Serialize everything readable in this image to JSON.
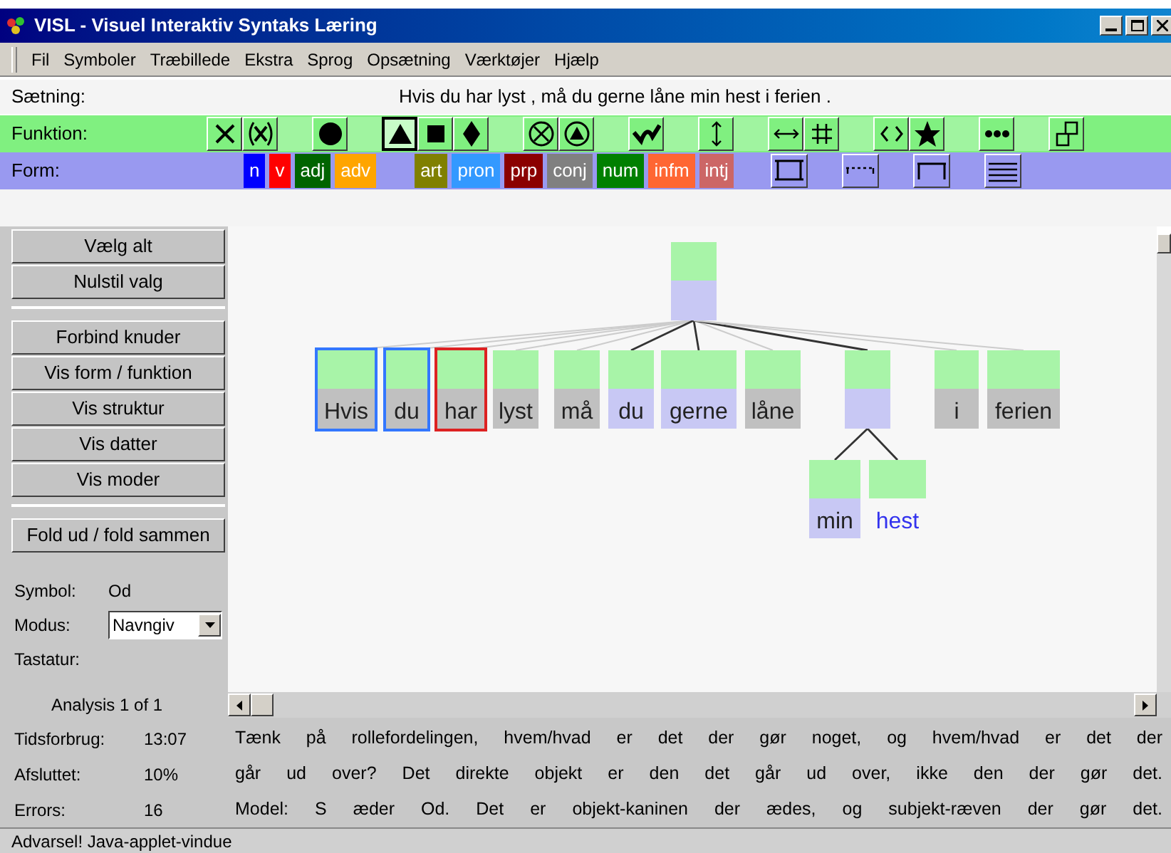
{
  "window": {
    "title": "VISL - Visuel Interaktiv Syntaks Læring"
  },
  "menu": [
    "Fil",
    "Symboler",
    "Træbillede",
    "Ekstra",
    "Sprog",
    "Opsætning",
    "Værktøjer",
    "Hjælp"
  ],
  "sentence": {
    "label": "Sætning:",
    "text": "Hvis du har lyst , må du gerne låne min hest i ferien ."
  },
  "function_bar": {
    "label": "Funktion:",
    "buttons": [
      {
        "kind": "cross",
        "selected": false
      },
      {
        "kind": "parencross",
        "selected": false
      },
      {
        "kind": "gap"
      },
      {
        "kind": "dot",
        "selected": false
      },
      {
        "kind": "gap"
      },
      {
        "kind": "triangle",
        "selected": true
      },
      {
        "kind": "square",
        "selected": false
      },
      {
        "kind": "diamond",
        "selected": false
      },
      {
        "kind": "gap"
      },
      {
        "kind": "otimes",
        "selected": false
      },
      {
        "kind": "otriangle",
        "selected": false
      },
      {
        "kind": "gap"
      },
      {
        "kind": "wave",
        "selected": false
      },
      {
        "kind": "gap"
      },
      {
        "kind": "vertical",
        "selected": false
      },
      {
        "kind": "gap"
      },
      {
        "kind": "horizontal",
        "selected": false
      },
      {
        "kind": "hash",
        "selected": false
      },
      {
        "kind": "gap"
      },
      {
        "kind": "angles",
        "selected": false
      },
      {
        "kind": "star",
        "selected": false
      },
      {
        "kind": "gap"
      },
      {
        "kind": "ellipsis",
        "selected": false
      },
      {
        "kind": "gap"
      },
      {
        "kind": "squares",
        "selected": false
      }
    ]
  },
  "form_bar": {
    "label": "Form:",
    "tags": [
      {
        "text": "n",
        "color": "#0000ff"
      },
      {
        "text": "v",
        "color": "#ff0000"
      },
      {
        "text": "adj",
        "color": "#006400"
      },
      {
        "text": "adv",
        "color": "#ffa500"
      },
      {
        "text": "art",
        "color": "#808000"
      },
      {
        "text": "pron",
        "color": "#3399ff"
      },
      {
        "text": "prp",
        "color": "#8b0000"
      },
      {
        "text": "conj",
        "color": "#808080"
      },
      {
        "text": "num",
        "color": "#008000"
      },
      {
        "text": "infm",
        "color": "#ff6633"
      },
      {
        "text": "intj",
        "color": "#cc6666"
      }
    ],
    "shapes": [
      {
        "kind": "frame"
      },
      {
        "kind": "dashed"
      },
      {
        "kind": "bracket"
      },
      {
        "kind": "lines"
      }
    ]
  },
  "side_buttons": [
    {
      "label": "Vælg alt",
      "kind": "button"
    },
    {
      "label": "Nulstil valg",
      "kind": "button"
    },
    {
      "kind": "separator"
    },
    {
      "label": "Forbind knuder",
      "kind": "button"
    },
    {
      "label": "Vis form / funktion",
      "kind": "button"
    },
    {
      "label": "Vis struktur",
      "kind": "button"
    },
    {
      "label": "Vis datter",
      "kind": "button"
    },
    {
      "label": "Vis moder",
      "kind": "button"
    },
    {
      "kind": "separator"
    },
    {
      "label": "Fold ud / fold sammen",
      "kind": "button"
    }
  ],
  "info": {
    "symbol_label": "Symbol:",
    "symbol": "Od",
    "mode_label": "Modus:",
    "mode": "Navngiv",
    "keyboard_label": "Tastatur:",
    "analysis": "Analysis 1 of 1"
  },
  "tree": {
    "color": "#c8c8f4",
    "children": [
      {
        "word": "Hvis",
        "color": "#c0c0c0",
        "selected": true,
        "error": false,
        "active": false,
        "linked": false
      },
      {
        "word": "du",
        "color": "#c0c0c0",
        "selected": true,
        "error": false,
        "active": false,
        "linked": false
      },
      {
        "word": "har",
        "color": "#c0c0c0",
        "selected": false,
        "error": true,
        "active": false,
        "linked": false
      },
      {
        "word": "lyst",
        "color": "#c0c0c0",
        "selected": false,
        "error": false,
        "active": false,
        "linked": false
      },
      {
        "word": "må",
        "color": "#c0c0c0",
        "selected": false,
        "error": false,
        "active": false,
        "linked": false
      },
      {
        "word": "du",
        "color": "#c8c8f4",
        "selected": false,
        "error": false,
        "active": false,
        "linked": true
      },
      {
        "word": "gerne",
        "color": "#c8c8f4",
        "selected": false,
        "error": false,
        "active": false,
        "linked": true
      },
      {
        "word": "låne",
        "color": "#c0c0c0",
        "selected": false,
        "error": false,
        "active": false,
        "linked": false
      },
      {
        "color": "#c8c8f4",
        "selected": false,
        "error": false,
        "active": false,
        "linked": true,
        "children": [
          {
            "word": "min",
            "color": "#c8c8f4",
            "selected": false,
            "error": false,
            "active": false,
            "linked": true
          },
          {
            "word": "hest",
            "selected": false,
            "error": false,
            "active": true,
            "linked": true
          }
        ]
      },
      {
        "word": "i",
        "color": "#c0c0c0",
        "selected": false,
        "error": false,
        "active": false,
        "linked": false
      },
      {
        "word": "ferien",
        "color": "#c0c0c0",
        "selected": false,
        "error": false,
        "active": false,
        "linked": false
      }
    ]
  },
  "stats": [
    {
      "label": "Tidsforbrug:",
      "value": "13:07"
    },
    {
      "label": "Afsluttet:",
      "value": "10%"
    },
    {
      "label": "Errors:",
      "value": "16"
    }
  ],
  "message": {
    "lines": [
      "Tænk på rollefordelingen, hvem/hvad er det der gør noget, og hvem/hvad er det der",
      "går ud over? Det direkte objekt er den det går ud over, ikke den der gør det.",
      "Model: S æder Od. Det er objekt-kaninen der ædes, og subjekt-ræven der gør det."
    ]
  },
  "status_bar": "Advarsel! Java-applet-vindue"
}
